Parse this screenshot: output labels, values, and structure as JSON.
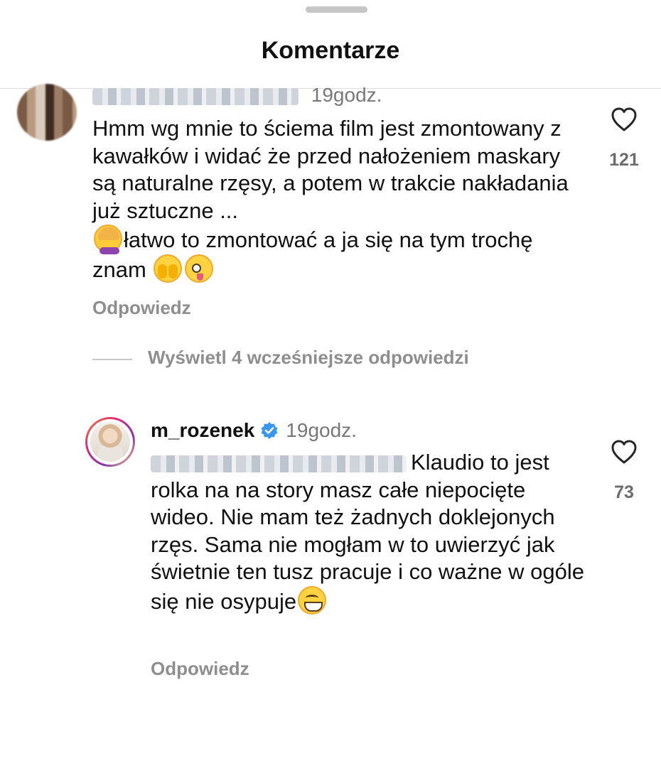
{
  "header": {
    "title": "Komentarze"
  },
  "comments": [
    {
      "time": "19godz.",
      "text": "Hmm wg mnie to ściema film jest zmontowany z kawałków i widać że przed nałożeniem maskary są naturalne rzęsy, a potem w trakcie nakładania  już sztuczne ...",
      "text_cont": "łatwo to zmontować a ja się na tym trochę znam",
      "emoji": [
        "facepalm",
        "see-no-evil-peek",
        "winking-tongue"
      ],
      "likes": "121",
      "reply_label": "Odpowiedz"
    }
  ],
  "view_replies": {
    "label": "Wyświetl 4 wcześniejsze odpowiedzi"
  },
  "reply": {
    "username": "m_rozenek",
    "verified": true,
    "time": "19godz.",
    "text": "Klaudio to jest rolka na na story masz całe niepocięte wideo. Nie mam też żadnych doklejonych rzęs. Sama nie mogłam w to uwierzyć jak świetnie ten tusz pracuje i co ważne w ogóle się nie osypuje",
    "emoji": [
      "grinning"
    ],
    "likes": "73",
    "reply_label": "Odpowiedz"
  },
  "colors": {
    "verified": "#3897f0",
    "muted": "#8e8e8e"
  }
}
